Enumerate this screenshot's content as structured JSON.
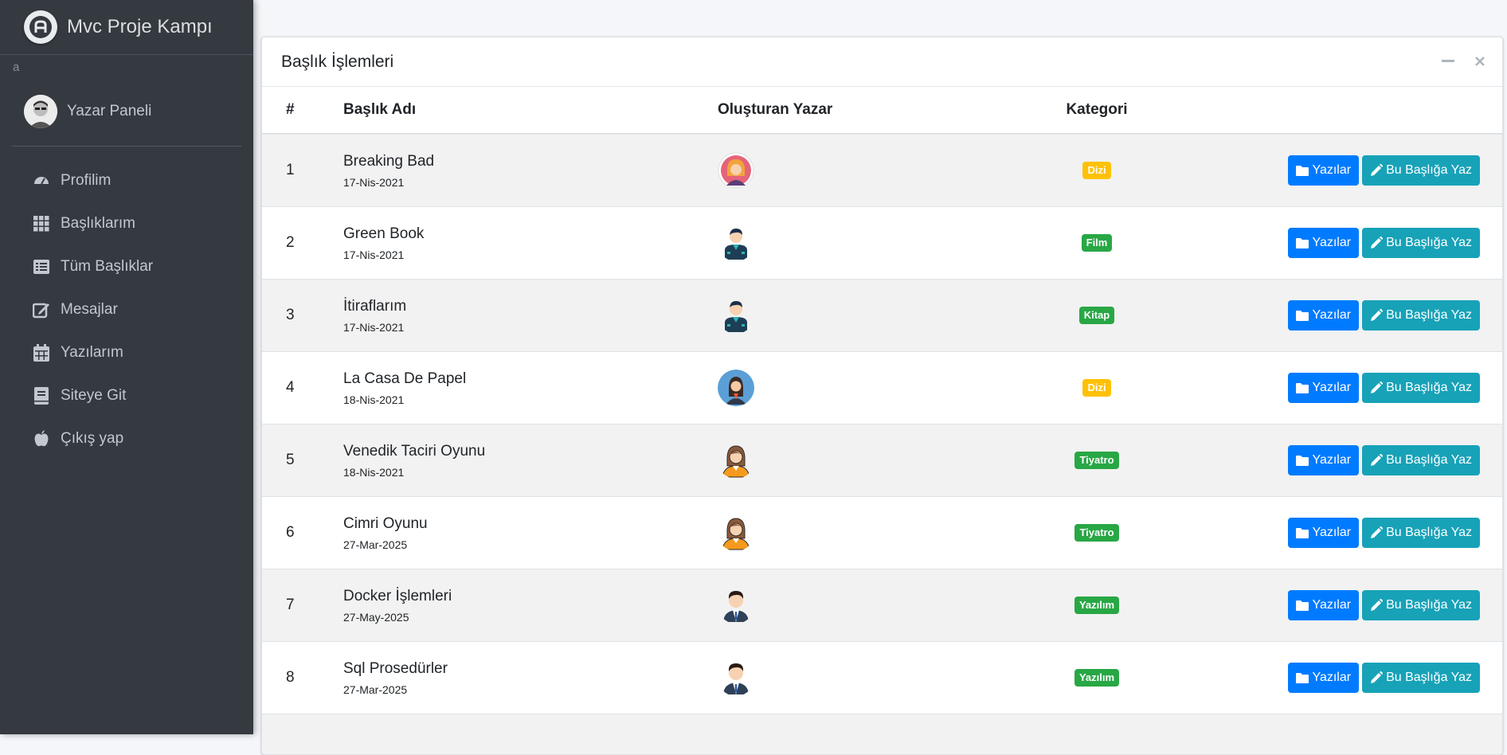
{
  "brand": {
    "title": "Mvc Proje Kampı"
  },
  "stray_text": "a",
  "user": {
    "name": "Yazar Paneli"
  },
  "nav": [
    {
      "label": "Profilim",
      "icon": "tachometer-icon"
    },
    {
      "label": "Başlıklarım",
      "icon": "grid-icon"
    },
    {
      "label": "Tüm Başlıklar",
      "icon": "list-icon"
    },
    {
      "label": "Mesajlar",
      "icon": "edit-icon"
    },
    {
      "label": "Yazılarım",
      "icon": "calendar-icon"
    },
    {
      "label": "Siteye Git",
      "icon": "book-icon"
    },
    {
      "label": "Çıkış yap",
      "icon": "apple-icon"
    }
  ],
  "card": {
    "title": "Başlık İşlemleri",
    "headers": {
      "num": "#",
      "name": "Başlık Adı",
      "author": "Oluşturan Yazar",
      "category": "Kategori"
    },
    "buttons": {
      "posts": "Yazılar",
      "write": "Bu Başlığa Yaz"
    },
    "rows": [
      {
        "num": "1",
        "title": "Breaking Bad",
        "date": "17-Nis-2021",
        "avatar": "woman-pink-avatar",
        "category": "Dizi",
        "category_color": "#ffc107"
      },
      {
        "num": "2",
        "title": "Green Book",
        "date": "17-Nis-2021",
        "avatar": "man-teal-avatar",
        "category": "Film",
        "category_color": "#28a745"
      },
      {
        "num": "3",
        "title": "İtiraflarım",
        "date": "17-Nis-2021",
        "avatar": "man-teal-avatar",
        "category": "Kitap",
        "category_color": "#28a745"
      },
      {
        "num": "4",
        "title": "La Casa De Papel",
        "date": "18-Nis-2021",
        "avatar": "woman-blue-avatar",
        "category": "Dizi",
        "category_color": "#ffc107"
      },
      {
        "num": "5",
        "title": "Venedik Taciri Oyunu",
        "date": "18-Nis-2021",
        "avatar": "woman-orange-avatar",
        "category": "Tiyatro",
        "category_color": "#28a745"
      },
      {
        "num": "6",
        "title": "Cimri Oyunu",
        "date": "27-Mar-2025",
        "avatar": "woman-orange-avatar",
        "category": "Tiyatro",
        "category_color": "#28a745"
      },
      {
        "num": "7",
        "title": "Docker İşlemleri",
        "date": "27-May-2025",
        "avatar": "man-suit-avatar",
        "category": "Yazılım",
        "category_color": "#28a745"
      },
      {
        "num": "8",
        "title": "Sql Prosedürler",
        "date": "27-Mar-2025",
        "avatar": "man-suit-avatar",
        "category": "Yazılım",
        "category_color": "#28a745"
      }
    ]
  }
}
